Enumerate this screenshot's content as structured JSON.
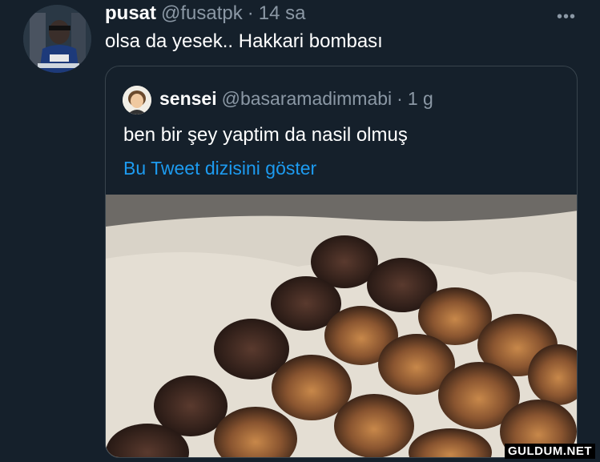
{
  "tweet": {
    "author_name": "pusat",
    "author_handle": "@fusatpk",
    "separator": "·",
    "time": "14 sa",
    "text": "olsa da yesek.. Hakkari bombası",
    "avatar_icon": "profile-avatar",
    "more_icon": "more-options-icon",
    "more_glyph": "•••"
  },
  "quoted": {
    "author_name": "sensei",
    "author_handle": "@basaramadimmabi",
    "separator": "·",
    "time": "1 g",
    "text": "ben bir şey yaptim da nasil olmuş",
    "thread_link": "Bu Tweet dizisini göster",
    "media_description": "photo"
  },
  "watermark": "GULDUM.NET",
  "colors": {
    "background": "#15202b",
    "text": "#ffffff",
    "muted": "#8b98a5",
    "link": "#1d9bf0",
    "border": "#38444d"
  }
}
